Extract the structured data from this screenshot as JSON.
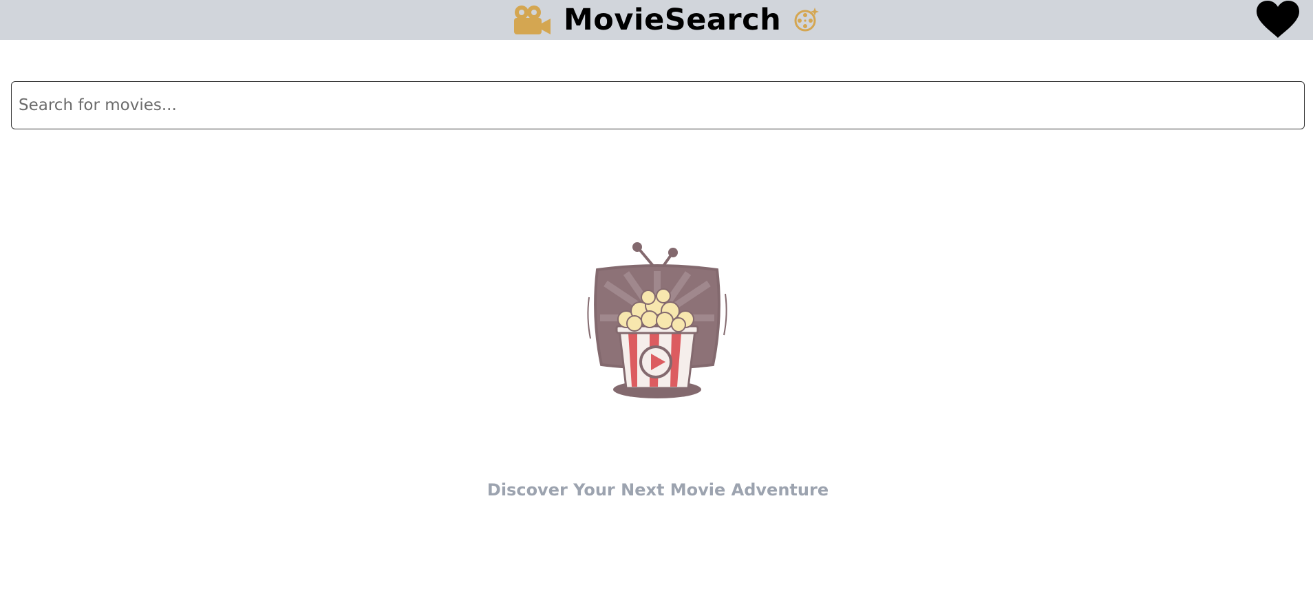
{
  "header": {
    "title": "MovieSearch",
    "logo_icon": "video-camera-icon",
    "badge_icon": "film-reel-sparkle-icon",
    "favorites_icon": "heart-icon",
    "background": "#d1d5db",
    "accent": "#d4a651"
  },
  "search": {
    "placeholder": "Search for movies...",
    "value": ""
  },
  "empty_state": {
    "illustration_icon": "popcorn-tv-icon",
    "message": "Discover Your Next Movie Adventure"
  }
}
